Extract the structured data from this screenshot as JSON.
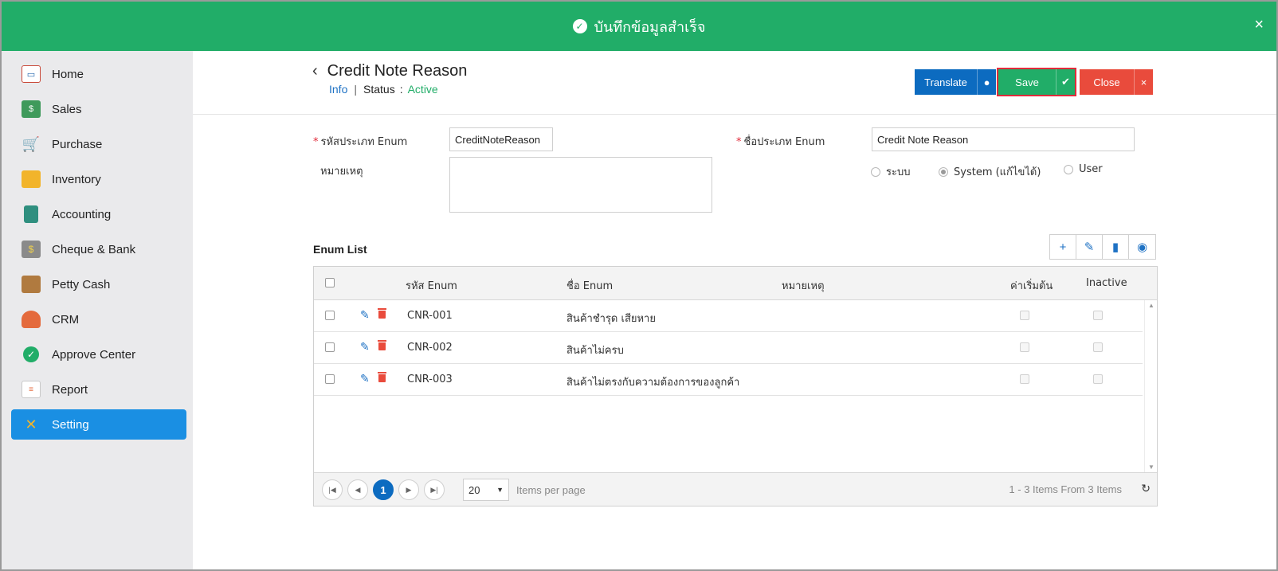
{
  "toast": {
    "message": "บันทึกข้อมูลสำเร็จ",
    "close": "×"
  },
  "sidebar": {
    "items": [
      {
        "label": "Home",
        "icon": "home-icon",
        "active": false
      },
      {
        "label": "Sales",
        "icon": "sales-icon",
        "active": false
      },
      {
        "label": "Purchase",
        "icon": "purchase-cart-icon",
        "active": false
      },
      {
        "label": "Inventory",
        "icon": "inventory-box-icon",
        "active": false
      },
      {
        "label": "Accounting",
        "icon": "accounting-book-icon",
        "active": false
      },
      {
        "label": "Cheque & Bank",
        "icon": "bank-icon",
        "active": false
      },
      {
        "label": "Petty Cash",
        "icon": "wallet-icon",
        "active": false
      },
      {
        "label": "CRM",
        "icon": "crm-person-icon",
        "active": false
      },
      {
        "label": "Approve Center",
        "icon": "approve-check-icon",
        "active": false
      },
      {
        "label": "Report",
        "icon": "report-icon",
        "active": false
      },
      {
        "label": "Setting",
        "icon": "setting-tools-icon",
        "active": true
      }
    ]
  },
  "header": {
    "title": "Credit Note Reason",
    "info": "Info",
    "status_label": "Status",
    "status_value": "Active"
  },
  "toolbar": {
    "translate": "Translate",
    "save": "Save",
    "close": "Close"
  },
  "form": {
    "code_label": "รหัสประเภท Enum",
    "code_value": "CreditNoteReason",
    "name_label": "ชื่อประเภท Enum",
    "name_value": "Credit Note Reason",
    "note_label": "หมายเหตุ",
    "note_value": "",
    "radio_options": [
      "ระบบ",
      "System (แก้ไขได้)",
      "User"
    ],
    "radio_selected": "System (แก้ไขได้)"
  },
  "enum_list": {
    "title": "Enum List",
    "columns": [
      "รหัส Enum",
      "ชื่อ Enum",
      "หมายเหตุ",
      "ค่าเริ่มต้น",
      "Inactive"
    ],
    "rows": [
      {
        "code": "CNR-001",
        "name": "สินค้าชำรุด เสียหาย",
        "note": "",
        "default": false,
        "inactive": false
      },
      {
        "code": "CNR-002",
        "name": "สินค้าไม่ครบ",
        "note": "",
        "default": false,
        "inactive": false
      },
      {
        "code": "CNR-003",
        "name": "สินค้าไม่ตรงกับความต้องการของลูกค้า",
        "note": "",
        "default": false,
        "inactive": false
      }
    ]
  },
  "pager": {
    "current_page": "1",
    "page_size": "20",
    "items_per_page_label": "Items per page",
    "summary": "1 - 3 Items From 3 Items"
  }
}
